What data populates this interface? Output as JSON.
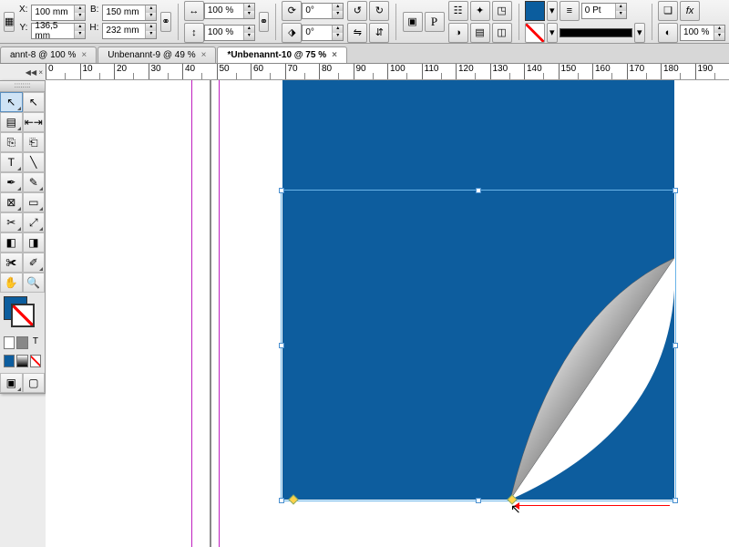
{
  "coords": {
    "x_label": "X:",
    "x": "100 mm",
    "y_label": "Y:",
    "y": "136,5 mm",
    "w_label": "B:",
    "w": "150 mm",
    "h_label": "H:",
    "h": "232 mm"
  },
  "scale": {
    "sx": "100 %",
    "sy": "100 %"
  },
  "rotate": {
    "angle": "0°",
    "shear": "0°"
  },
  "stroke": {
    "weight": "0 Pt",
    "opacity": "100 %"
  },
  "tabs": [
    {
      "label": "annt-8 @ 100 %",
      "active": false
    },
    {
      "label": "Unbenannt-9 @ 49 %",
      "active": false
    },
    {
      "label": "*Unbenannt-10 @ 75 %",
      "active": true
    }
  ],
  "ruler_ticks": [
    "0",
    "10",
    "20",
    "30",
    "40",
    "50",
    "60",
    "70",
    "80",
    "90",
    "100",
    "110",
    "120",
    "130",
    "140",
    "150",
    "160",
    "170",
    "180",
    "190"
  ],
  "colors": {
    "fill": "#0d5d9e"
  }
}
